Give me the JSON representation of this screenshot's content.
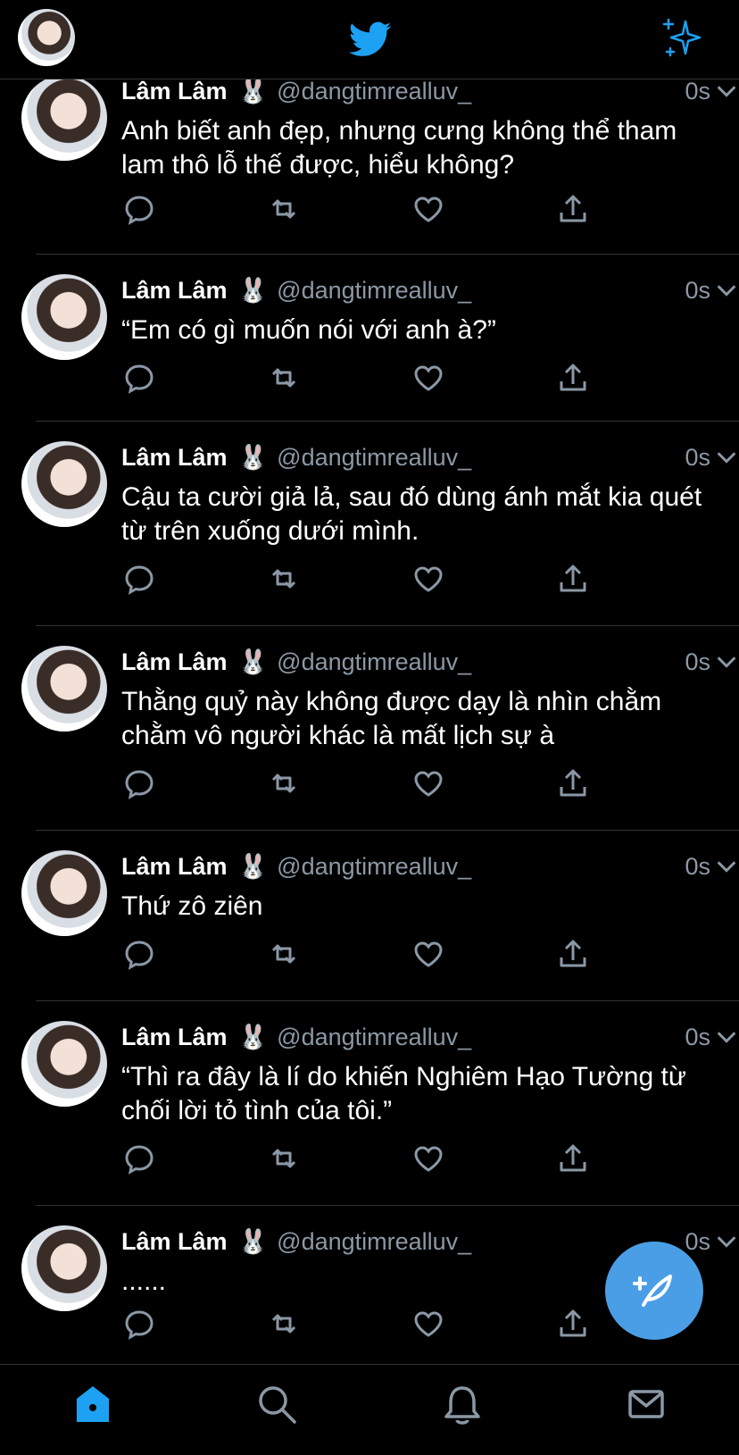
{
  "header": {
    "logo": "twitter-bird-icon",
    "sparkle": "sparkle-icon"
  },
  "colors": {
    "accent": "#1da1f2",
    "fab": "#4a9ee6",
    "muted": "#8b98a5",
    "divider": "#2f3336"
  },
  "tweets": [
    {
      "name": "Lâm Lâm",
      "emoji": "🐰",
      "handle": "@dangtimrealluv_",
      "time": "0s",
      "text": "Anh biết anh đẹp, nhưng cưng không thể tham lam thô lỗ thế được, hiểu không?"
    },
    {
      "name": "Lâm Lâm",
      "emoji": "🐰",
      "handle": "@dangtimrealluv_",
      "time": "0s",
      "text": "“Em có gì muốn nói với anh à?”"
    },
    {
      "name": "Lâm Lâm",
      "emoji": "🐰",
      "handle": "@dangtimrealluv_",
      "time": "0s",
      "text": "Cậu ta cười giả lả, sau đó dùng ánh mắt kia quét từ trên xuống dưới mình."
    },
    {
      "name": "Lâm Lâm",
      "emoji": "🐰",
      "handle": "@dangtimrealluv_",
      "time": "0s",
      "text": "Thằng quỷ này không được dạy là nhìn chằm chằm vô người khác là mất lịch sự à"
    },
    {
      "name": "Lâm Lâm",
      "emoji": "🐰",
      "handle": "@dangtimrealluv_",
      "time": "0s",
      "text": "Thứ zô ziên"
    },
    {
      "name": "Lâm Lâm",
      "emoji": "🐰",
      "handle": "@dangtimrealluv_",
      "time": "0s",
      "text": "“Thì ra đây là lí do khiến Nghiêm Hạo Tường từ chối lời tỏ tình của tôi.”"
    },
    {
      "name": "Lâm Lâm",
      "emoji": "🐰",
      "handle": "@dangtimrealluv_",
      "time": "0s",
      "text": "......"
    }
  ],
  "tabbar": {
    "items": [
      "home-icon",
      "search-icon",
      "notifications-icon",
      "messages-icon"
    ]
  }
}
